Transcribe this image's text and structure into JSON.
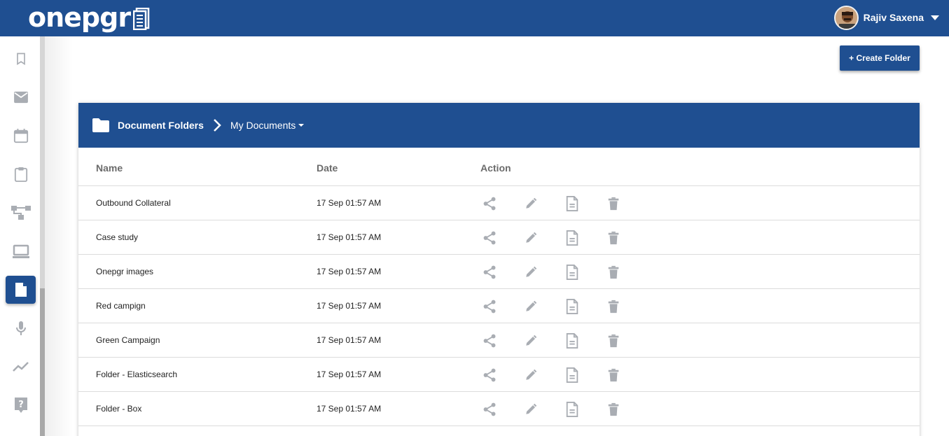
{
  "app": {
    "logo_text": "onepgr",
    "user_name": "Rajiv Saxena"
  },
  "sidebar": {
    "items": [
      {
        "name": "bookmark-icon",
        "active": false
      },
      {
        "name": "mail-icon",
        "active": false
      },
      {
        "name": "calendar-icon",
        "active": false
      },
      {
        "name": "clipboard-icon",
        "active": false
      },
      {
        "name": "hierarchy-icon",
        "active": false
      },
      {
        "name": "laptop-icon",
        "active": false
      },
      {
        "name": "document-icon",
        "active": true
      },
      {
        "name": "microphone-icon",
        "active": false
      },
      {
        "name": "trend-line-icon",
        "active": false
      },
      {
        "name": "help-icon",
        "active": false
      }
    ]
  },
  "toolbar": {
    "create_folder_label": "+ Create Folder"
  },
  "breadcrumb": {
    "root": "Document Folders",
    "current": "My Documents"
  },
  "table": {
    "columns": [
      "Name",
      "Date",
      "Action"
    ],
    "rows": [
      {
        "name": "Outbound Collateral",
        "date": "17 Sep 01:57 AM"
      },
      {
        "name": "Case study",
        "date": "17 Sep 01:57 AM"
      },
      {
        "name": "Onepgr images",
        "date": "17 Sep 01:57 AM"
      },
      {
        "name": "Red campign",
        "date": "17 Sep 01:57 AM"
      },
      {
        "name": "Green Campaign",
        "date": "17 Sep 01:57 AM"
      },
      {
        "name": "Folder - Elasticsearch",
        "date": "17 Sep 01:57 AM"
      },
      {
        "name": "Folder - Box",
        "date": "17 Sep 01:57 AM"
      }
    ],
    "row_actions": [
      "share-icon",
      "edit-icon",
      "document-icon",
      "delete-icon"
    ]
  },
  "colors": {
    "brand": "#1f4f91",
    "icon_gray": "#a9adb3"
  }
}
